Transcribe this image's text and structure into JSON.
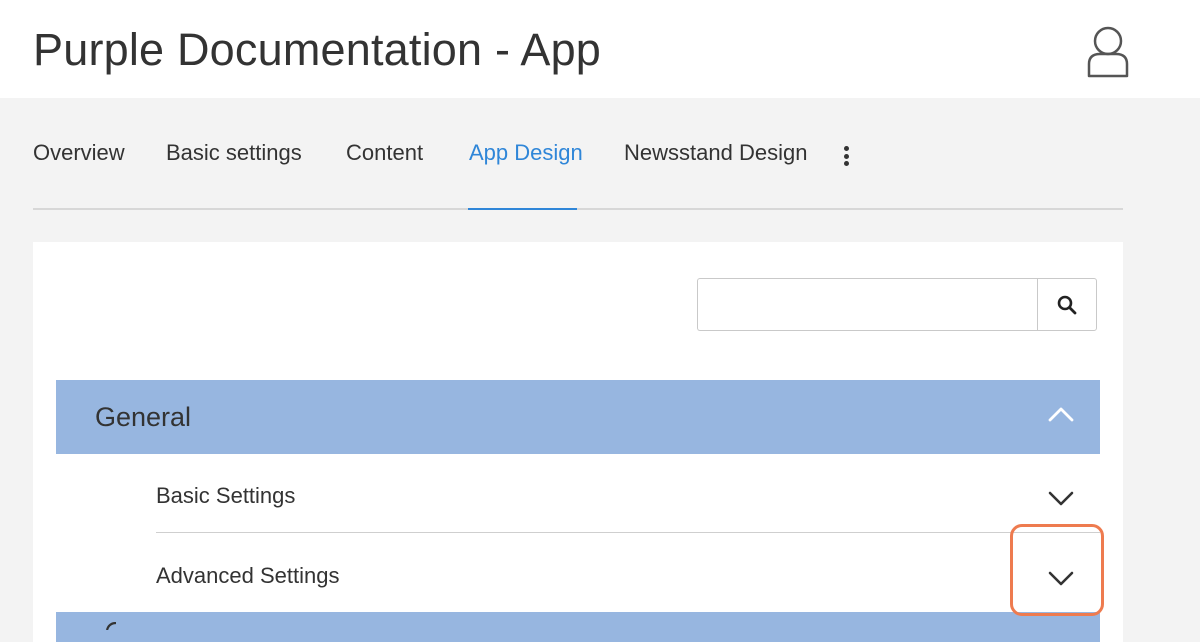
{
  "header": {
    "title": "Purple Documentation - App",
    "avatar_icon": "user-icon"
  },
  "tabs": [
    {
      "label": "Overview",
      "active": false
    },
    {
      "label": "Basic settings",
      "active": false
    },
    {
      "label": "Content",
      "active": false
    },
    {
      "label": "App Design",
      "active": true
    },
    {
      "label": "Newsstand Design",
      "active": false
    }
  ],
  "more_menu_icon": "vertical-ellipsis-icon",
  "search": {
    "value": "",
    "placeholder": "",
    "button_icon": "search-icon"
  },
  "sections": [
    {
      "title": "General",
      "expanded": true,
      "toggle_icon": "chevron-up-icon",
      "items": [
        {
          "label": "Basic Settings",
          "icon": "chevron-down-icon"
        },
        {
          "label": "Advanced Settings",
          "icon": "chevron-down-icon",
          "highlighted": true
        }
      ]
    }
  ],
  "colors": {
    "accent": "#2f86d8",
    "section_header": "#97b6e0",
    "highlight": "#ee7b4f",
    "background": "#f3f3f3"
  }
}
